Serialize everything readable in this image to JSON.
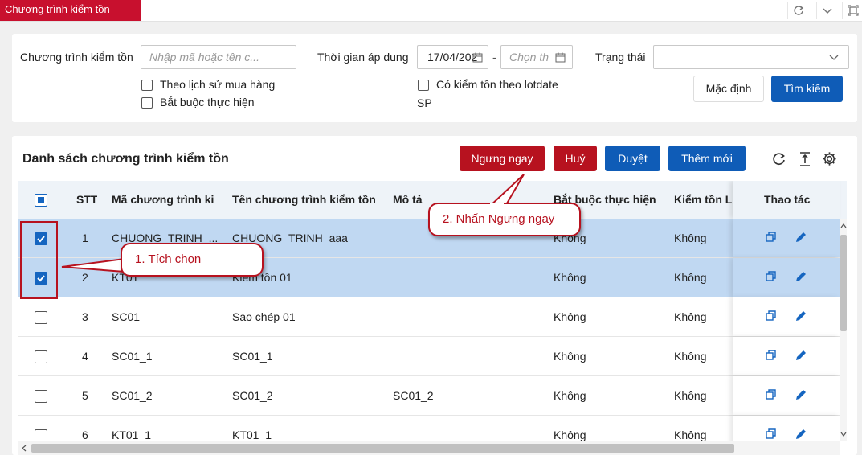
{
  "window": {
    "title": "Chương trình kiểm tồn"
  },
  "filters": {
    "program_label": "Chương trình kiểm tồn",
    "program_placeholder": "Nhập mã hoặc tên c...",
    "time_label": "Thời gian áp dung",
    "date_from": "17/04/202",
    "date_sep": "-",
    "date_to_placeholder": "Chọn th",
    "status_label": "Trạng thái",
    "status_value": "",
    "cb_purchase_history": "Theo lịch sử mua hàng",
    "cb_mandatory": "Bắt buộc thực hiện",
    "cb_lotdate": "Có kiểm tồn theo lotdate",
    "cb_lotdate_cont": "SP",
    "default_btn": "Mặc định",
    "search_btn": "Tìm kiếm"
  },
  "list": {
    "title": "Danh sách chương trình kiểm tồn",
    "btn_stop": "Ngưng ngay",
    "btn_cancel": "Huỷ",
    "btn_approve": "Duyệt",
    "btn_add": "Thêm mới",
    "columns": {
      "stt": "STT",
      "code": "Mã chương trình ki",
      "name": "Tên chương trình kiểm tồn",
      "desc": "Mô tả",
      "mandatory": "Bắt buộc thực hiện",
      "lot": "Kiểm tồn L",
      "actions": "Thao tác"
    },
    "rows": [
      {
        "stt": "1",
        "code": "CHUONG_TRINH_...",
        "name": "CHUONG_TRINH_aaa",
        "desc": "",
        "mandatory": "Không",
        "lot": "Không",
        "checked": true
      },
      {
        "stt": "2",
        "code": "KT01",
        "name": "Kiểm tồn 01",
        "desc": "",
        "mandatory": "Không",
        "lot": "Không",
        "checked": true
      },
      {
        "stt": "3",
        "code": "SC01",
        "name": "Sao chép 01",
        "desc": "",
        "mandatory": "Không",
        "lot": "Không",
        "checked": false
      },
      {
        "stt": "4",
        "code": "SC01_1",
        "name": "SC01_1",
        "desc": "",
        "mandatory": "Không",
        "lot": "Không",
        "checked": false
      },
      {
        "stt": "5",
        "code": "SC01_2",
        "name": "SC01_2",
        "desc": "SC01_2",
        "mandatory": "Không",
        "lot": "Không",
        "checked": false
      },
      {
        "stt": "6",
        "code": "KT01_1",
        "name": "KT01_1",
        "desc": "",
        "mandatory": "Không",
        "lot": "Không",
        "checked": false
      }
    ]
  },
  "annotations": {
    "step1": "1. Tích chọn",
    "step2": "2. Nhấn Ngưng ngay"
  },
  "colors": {
    "brand_red": "#c8102e",
    "primary_blue": "#0f5cb7",
    "selected_row": "#c0d8f2"
  }
}
